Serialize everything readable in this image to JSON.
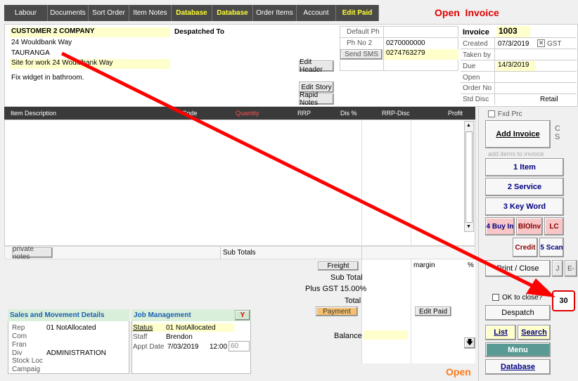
{
  "tabs": [
    "Labour",
    "Documents",
    "Sort Order",
    "Item Notes",
    "Database",
    "Database",
    "Order Items",
    "Account",
    "Edit Paid"
  ],
  "status_title": "Open  Invoice",
  "customer": {
    "name": "CUSTOMER 2 COMPANY",
    "address1": "24 Wouldbank Way",
    "city": "TAURANGA",
    "site": "Site for work 24 Wouldbank Way",
    "description": "Fix widget in bathroom."
  },
  "despatched_to_label": "Despatched To",
  "header_buttons": {
    "edit_header": "Edit Header",
    "edit_story": "Edit Story",
    "rapid_notes": "Rapid Notes"
  },
  "contact": {
    "default_ph_label": "Default Ph",
    "ph_no2_label": "Ph No 2",
    "ph_no2": "0270000000",
    "send_sms_label": "Send SMS",
    "send_sms_number": "0274763279"
  },
  "invoice": {
    "invoice_label": "Invoice",
    "number": "1003",
    "created_label": "Created",
    "created": "07/3/2019",
    "gst_label": "GST",
    "taken_by_label": "Taken by",
    "due_label": "Due",
    "due": "14/3/2019",
    "open_label": "Open",
    "order_no_label": "Order No",
    "std_disc_label": "Std Disc",
    "std_disc": "Retail"
  },
  "grid_headers": [
    "Item Description",
    "Code",
    "Quantity",
    "RRP",
    "Dis %",
    "RRP-Disc",
    "Profit"
  ],
  "private_notes": "private notes",
  "sub_totals_label": "Sub Totals",
  "totals": {
    "freight": "Freight",
    "sub_total": "Sub Total",
    "plus_gst": "Plus GST 15.00%",
    "total": "Total",
    "payment": "Payment",
    "balance": "Balance",
    "margin": "margin",
    "pct": "%",
    "edit_paid": "Edit Paid"
  },
  "sales": {
    "title": "Sales and Movement Details",
    "rep_label": "Rep",
    "rep": "01 NotAllocated",
    "com_label": "Com",
    "fran_label": "Fran",
    "div_label": "Div",
    "div": "ADMINISTRATION",
    "stock_loc_label": "Stock Loc",
    "campaign_label": "Campaig"
  },
  "job": {
    "title": "Job Management",
    "y": "Y",
    "status_label": "Status",
    "status": "01 NotAllocated",
    "staff_label": "Staff",
    "staff": "Brendon",
    "appt_label": "Appt Date",
    "appt_date": "7/03/2019",
    "appt_time": "12:00",
    "appt_dur": "60"
  },
  "side": {
    "fxd_prc": "Fxd Prc",
    "add_invoice": "Add Invoice",
    "cs": "C\nS",
    "add_items_hint": "add items to invoice",
    "item": "1 Item",
    "service": "2 Service",
    "keyword": "3 Key Word",
    "buy_in": "4 Buy In",
    "blolnv": "BlOlnv",
    "lc": "LC",
    "credit": "Credit",
    "scan": "5 Scan",
    "print_close": "Print / Close",
    "j": "J",
    "e": "E-",
    "ok_to_close": "OK to close?",
    "counter": "30",
    "despatch": "Despatch",
    "list": "List",
    "search": "Search",
    "menu": "Menu",
    "database": "Database"
  },
  "bottom_status": "Open",
  "colors": {
    "accent_red": "#e00000",
    "tab_bg": "#4a4a4a",
    "highlight_yellow": "#ffff33",
    "menu_teal": "#5a9a94"
  }
}
